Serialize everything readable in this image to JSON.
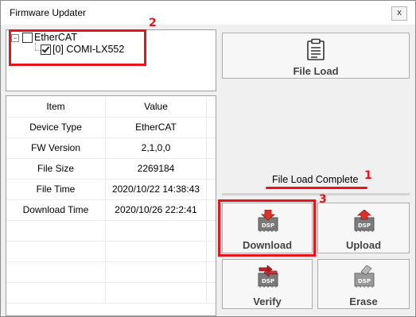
{
  "window": {
    "title": "Firmware Updater",
    "close_glyph": "x"
  },
  "tree": {
    "root": {
      "label": "EtherCAT",
      "expander": "−",
      "checked": false
    },
    "child": {
      "label": "[0]  COMI-LX552",
      "checked": true
    }
  },
  "table": {
    "headers": [
      "Item",
      "Value"
    ],
    "rows": [
      [
        "Device Type",
        "EtherCAT"
      ],
      [
        "FW Version",
        "2,1,0,0"
      ],
      [
        "File Size",
        "2269184"
      ],
      [
        "File Time",
        "2020/10/22 14:38:43"
      ],
      [
        "Download Time",
        "2020/10/26 22:2:41"
      ]
    ]
  },
  "buttons": {
    "file_load": "File Load",
    "download": "Download",
    "upload": "Upload",
    "verify": "Verify",
    "erase": "Erase",
    "dsp_chip_text": "DSP"
  },
  "status": "File Load Complete",
  "annotations": {
    "one": "1",
    "two": "2",
    "three": "3"
  },
  "colors": {
    "annotation": "#e8141c",
    "download_arrow": "#d9342b",
    "upload_arrow": "#d9342b",
    "verify_arrow": "#c0202a",
    "chip": "#7a7a7a"
  }
}
